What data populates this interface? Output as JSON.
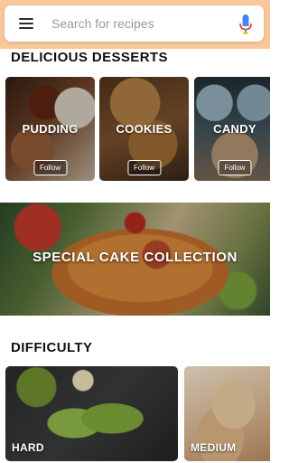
{
  "search": {
    "placeholder": "Search for recipes",
    "menu_icon": "menu-icon",
    "mic_icon": "mic-icon",
    "header_color": "#f9c89a"
  },
  "sections": {
    "desserts_title": "DELICIOUS DESSERTS",
    "difficulty_title": "DIFFICULTY"
  },
  "categories": [
    {
      "label": "PUDDING",
      "button": "Follow"
    },
    {
      "label": "COOKIES",
      "button": "Follow"
    },
    {
      "label": "CANDY",
      "button": "Follow"
    }
  ],
  "feature": {
    "label": "SPECIAL CAKE COLLECTION"
  },
  "difficulty": [
    {
      "label": "HARD"
    },
    {
      "label": "MEDIUM"
    }
  ]
}
